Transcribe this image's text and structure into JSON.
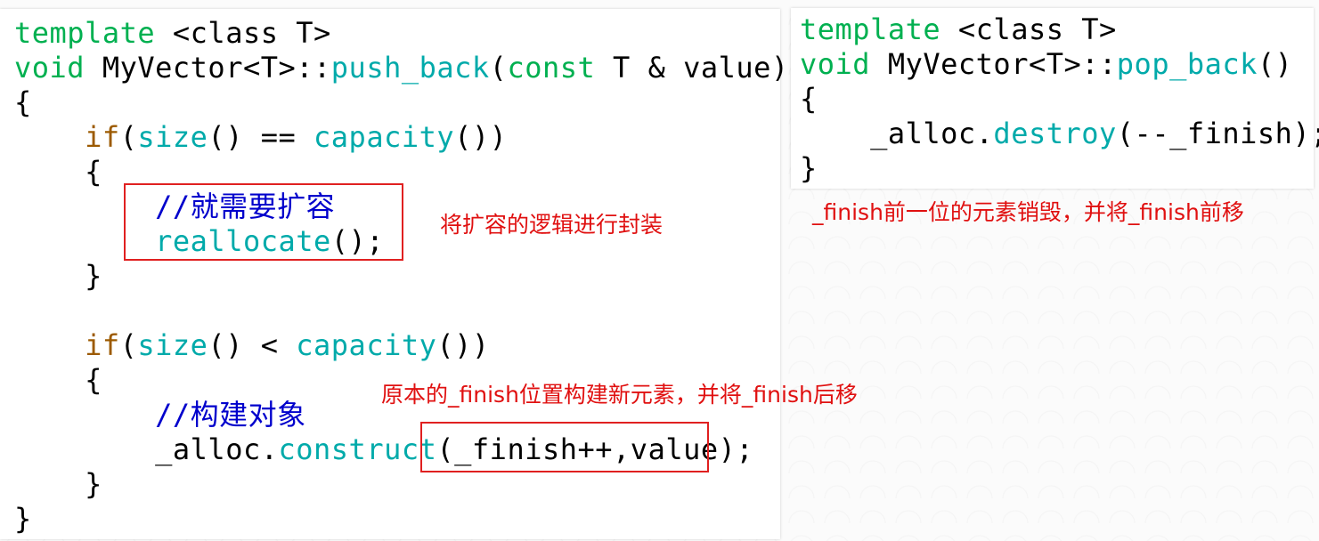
{
  "push_back": {
    "line1": {
      "kw": "template",
      "rest": " <class T>"
    },
    "line2": {
      "kw": "void",
      "mid": " MyVector<T>::",
      "fn": "push_back",
      "p1": "(",
      "kw2": "const",
      "rest": " T & value)"
    },
    "line3": "{",
    "line4": {
      "indent": "    ",
      "kw": "if",
      "p1": "(",
      "fn1": "size",
      "mid": "() == ",
      "fn2": "capacity",
      "rest": "())"
    },
    "line5": "    {",
    "line6": {
      "indent": "        ",
      "comment_slash": "//",
      "comment_text": "就需要扩容"
    },
    "line7": {
      "indent": "        ",
      "fn": "reallocate",
      "rest": "();"
    },
    "line8": "    }",
    "line9": "",
    "line10": {
      "indent": "    ",
      "kw": "if",
      "p1": "(",
      "fn1": "size",
      "mid": "() < ",
      "fn2": "capacity",
      "rest": "())"
    },
    "line11": "    {",
    "line12": {
      "indent": "        ",
      "comment_slash": "//",
      "comment_text": "构建对象"
    },
    "line13": {
      "indent": "        ",
      "obj": "_alloc.",
      "fn": "construct",
      "rest": "(_finish++,value);"
    },
    "line14": "    }",
    "line15": "}"
  },
  "pop_back": {
    "line1": {
      "kw": "template",
      "rest": " <class T>"
    },
    "line2": {
      "kw": "void",
      "mid": " MyVector<T>::",
      "fn": "pop_back",
      "rest": "()"
    },
    "line3": "{",
    "line4": {
      "indent": "    ",
      "obj": "_alloc.",
      "fn": "destroy",
      "rest": "(--_finish);"
    },
    "line5": "}"
  },
  "annotations": {
    "reallocate_note": "将扩容的逻辑进行封装",
    "construct_note": "原本的_finish位置构建新元素，并将_finish后移",
    "destroy_note": "_finish前一位的元素销毁，并将_finish前移"
  },
  "colors": {
    "keyword": "#00b050",
    "control_keyword": "#9c5a00",
    "function": "#00aaaa",
    "comment": "#0000cc",
    "annotation": "#e01010",
    "box": "#e02020"
  }
}
